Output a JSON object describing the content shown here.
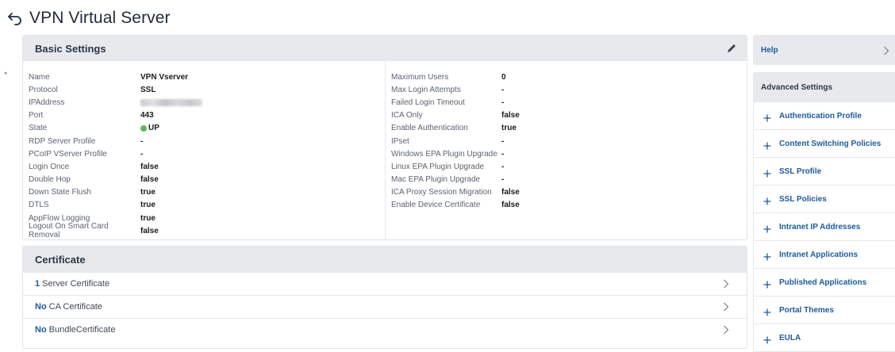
{
  "page": {
    "title": "VPN Virtual Server"
  },
  "icons": {
    "back": "back-arrow-icon",
    "edit": "pencil-icon",
    "chevron": "chevron-right-icon",
    "plus": "plus-icon"
  },
  "colors": {
    "accent": "#1d5a9a",
    "status_up": "#5cb85c",
    "header_bg": "#e8e9ed"
  },
  "basic_settings": {
    "title": "Basic Settings",
    "left": [
      {
        "label": "Name",
        "value": "VPN Vserver"
      },
      {
        "label": "Protocol",
        "value": "SSL"
      },
      {
        "label": "IPAddress",
        "value": ""
      },
      {
        "label": "Port",
        "value": "443"
      },
      {
        "label": "State",
        "value": "UP"
      },
      {
        "label": "RDP Server Profile",
        "value": "-"
      },
      {
        "label": "PCoIP VServer Profile",
        "value": "-"
      },
      {
        "label": "Login Once",
        "value": "false"
      },
      {
        "label": "Double Hop",
        "value": "false"
      },
      {
        "label": "Down State Flush",
        "value": "true"
      },
      {
        "label": "DTLS",
        "value": "true"
      },
      {
        "label": "AppFlow Logging",
        "value": "true"
      },
      {
        "label": "Logout On Smart Card Removal",
        "value": "false"
      }
    ],
    "right": [
      {
        "label": "Maximum Users",
        "value": "0"
      },
      {
        "label": "Max Login Attempts",
        "value": "-"
      },
      {
        "label": "Failed Login Timeout",
        "value": "-"
      },
      {
        "label": "ICA Only",
        "value": "false"
      },
      {
        "label": "Enable Authentication",
        "value": "true"
      },
      {
        "label": "IPset",
        "value": "-"
      },
      {
        "label": "Windows EPA Plugin Upgrade",
        "value": "-"
      },
      {
        "label": "Linux EPA Plugin Upgrade",
        "value": "-"
      },
      {
        "label": "Mac EPA Plugin Upgrade",
        "value": "-"
      },
      {
        "label": "ICA Proxy Session Migration",
        "value": "false"
      },
      {
        "label": "Enable Device Certificate",
        "value": "false"
      }
    ]
  },
  "certificate": {
    "title": "Certificate",
    "rows": [
      {
        "count": "1",
        "label": "Server Certificate"
      },
      {
        "count": "No",
        "label": "CA Certificate"
      },
      {
        "count": "No",
        "label": "BundleCertificate"
      }
    ]
  },
  "help": {
    "label": "Help"
  },
  "advanced_settings": {
    "title": "Advanced Settings",
    "items": [
      "Authentication Profile",
      "Content Switching Policies",
      "SSL Profile",
      "SSL Policies",
      "Intranet IP Addresses",
      "Intranet Applications",
      "Published Applications",
      "Portal Themes",
      "EULA"
    ]
  }
}
